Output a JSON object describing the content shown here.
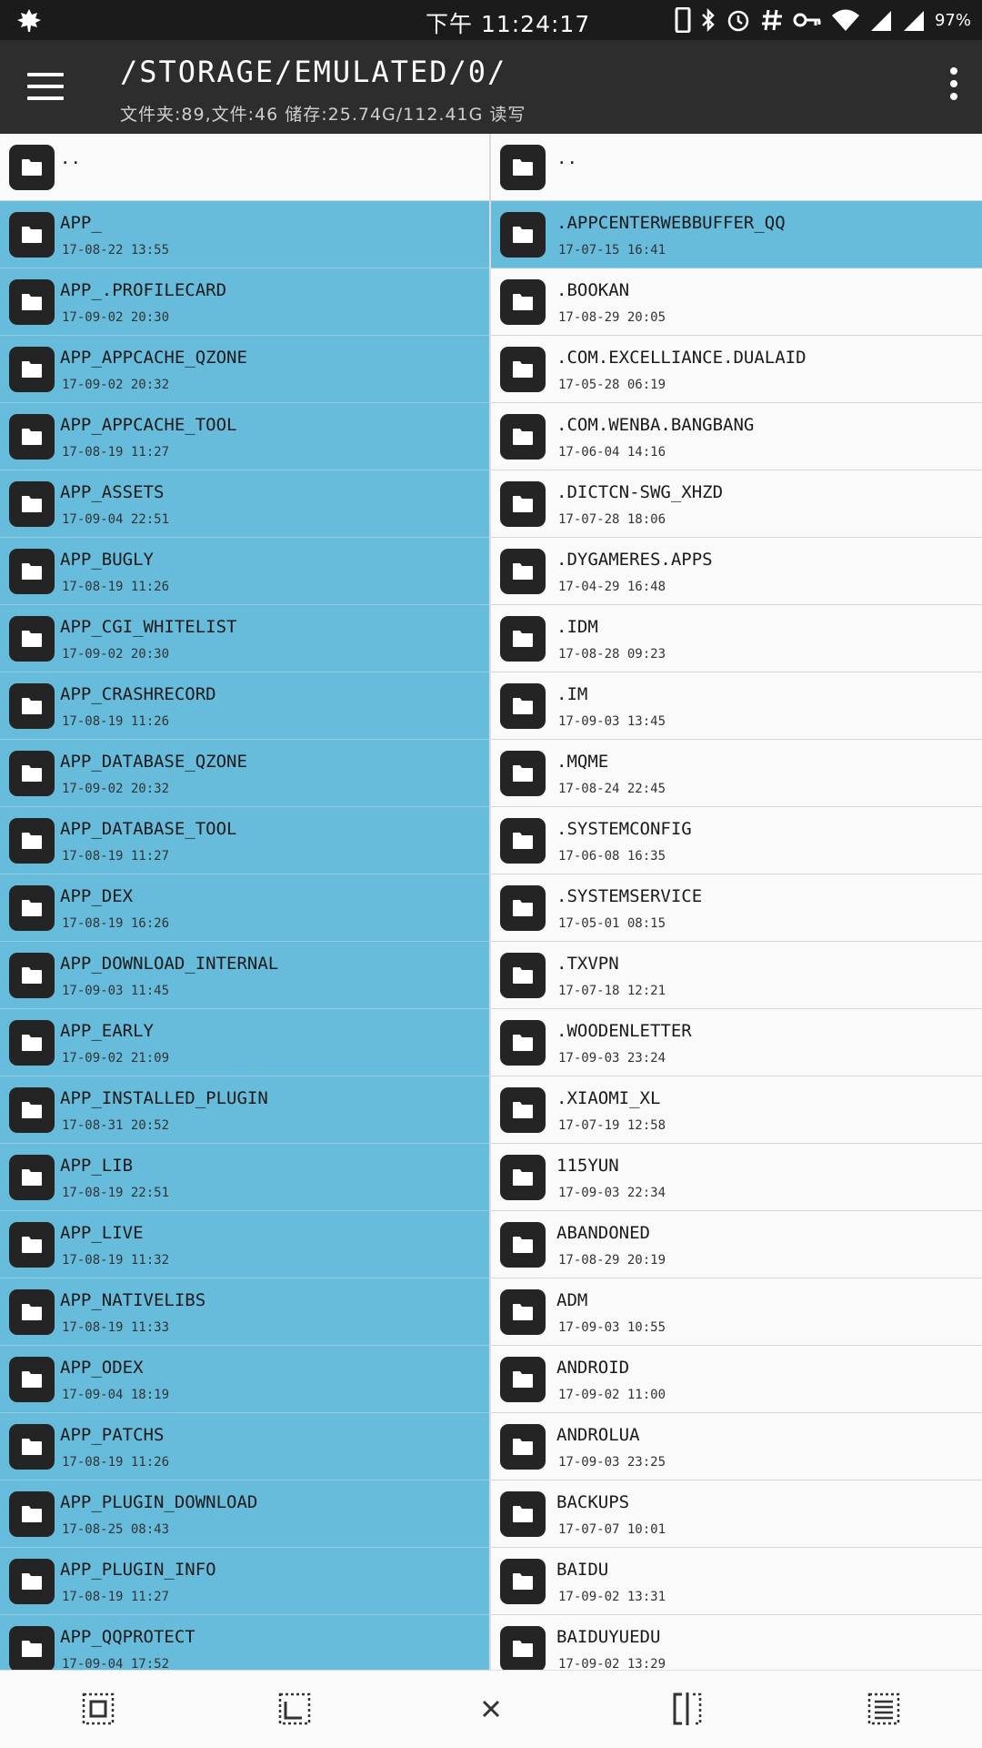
{
  "status_bar": {
    "time": "下午 11:24:17",
    "battery": "97%",
    "icons": [
      "leaf-icon",
      "phone-icon",
      "bluetooth-icon",
      "alarm-icon",
      "hash-icon",
      "key-icon",
      "wifi-icon",
      "signal-icon",
      "signal-icon",
      "battery-text"
    ]
  },
  "app_bar": {
    "path": "/STORAGE/EMULATED/0/",
    "summary": "文件夹:89,文件:46  储存:25.74G/112.41G  读写"
  },
  "left_pane": {
    "up_label": "..",
    "items": [
      {
        "name": "APP_",
        "date": "17-08-22 13:55",
        "selected": true
      },
      {
        "name": "APP_.PROFILECARD",
        "date": "17-09-02 20:30",
        "selected": true
      },
      {
        "name": "APP_APPCACHE_QZONE",
        "date": "17-09-02 20:32",
        "selected": true
      },
      {
        "name": "APP_APPCACHE_TOOL",
        "date": "17-08-19 11:27",
        "selected": true
      },
      {
        "name": "APP_ASSETS",
        "date": "17-09-04 22:51",
        "selected": true
      },
      {
        "name": "APP_BUGLY",
        "date": "17-08-19 11:26",
        "selected": true
      },
      {
        "name": "APP_CGI_WHITELIST",
        "date": "17-09-02 20:30",
        "selected": true
      },
      {
        "name": "APP_CRASHRECORD",
        "date": "17-08-19 11:26",
        "selected": true
      },
      {
        "name": "APP_DATABASE_QZONE",
        "date": "17-09-02 20:32",
        "selected": true
      },
      {
        "name": "APP_DATABASE_TOOL",
        "date": "17-08-19 11:27",
        "selected": true
      },
      {
        "name": "APP_DEX",
        "date": "17-08-19 16:26",
        "selected": true
      },
      {
        "name": "APP_DOWNLOAD_INTERNAL",
        "date": "17-09-03 11:45",
        "selected": true
      },
      {
        "name": "APP_EARLY",
        "date": "17-09-02 21:09",
        "selected": true
      },
      {
        "name": "APP_INSTALLED_PLUGIN",
        "date": "17-08-31 20:52",
        "selected": true
      },
      {
        "name": "APP_LIB",
        "date": "17-08-19 22:51",
        "selected": true
      },
      {
        "name": "APP_LIVE",
        "date": "17-08-19 11:32",
        "selected": true
      },
      {
        "name": "APP_NATIVELIBS",
        "date": "17-08-19 11:33",
        "selected": true
      },
      {
        "name": "APP_ODEX",
        "date": "17-09-04 18:19",
        "selected": true
      },
      {
        "name": "APP_PATCHS",
        "date": "17-08-19 11:26",
        "selected": true
      },
      {
        "name": "APP_PLUGIN_DOWNLOAD",
        "date": "17-08-25 08:43",
        "selected": true
      },
      {
        "name": "APP_PLUGIN_INFO",
        "date": "17-08-19 11:27",
        "selected": true
      },
      {
        "name": "APP_QQPROTECT",
        "date": "17-09-04 17:52",
        "selected": true
      }
    ]
  },
  "right_pane": {
    "up_label": "..",
    "items": [
      {
        "name": ".APPCENTERWEBBUFFER_QQ",
        "date": "17-07-15 16:41",
        "selected": true
      },
      {
        "name": ".BOOKAN",
        "date": "17-08-29 20:05",
        "selected": false
      },
      {
        "name": ".COM.EXCELLIANCE.DUALAID",
        "date": "17-05-28 06:19",
        "selected": false
      },
      {
        "name": ".COM.WENBA.BANGBANG",
        "date": "17-06-04 14:16",
        "selected": false
      },
      {
        "name": ".DICTCN-SWG_XHZD",
        "date": "17-07-28 18:06",
        "selected": false
      },
      {
        "name": ".DYGAMERES.APPS",
        "date": "17-04-29 16:48",
        "selected": false
      },
      {
        "name": ".IDM",
        "date": "17-08-28 09:23",
        "selected": false
      },
      {
        "name": ".IM",
        "date": "17-09-03 13:45",
        "selected": false
      },
      {
        "name": ".MQME",
        "date": "17-08-24 22:45",
        "selected": false
      },
      {
        "name": ".SYSTEMCONFIG",
        "date": "17-06-08 16:35",
        "selected": false
      },
      {
        "name": ".SYSTEMSERVICE",
        "date": "17-05-01 08:15",
        "selected": false
      },
      {
        "name": ".TXVPN",
        "date": "17-07-18 12:21",
        "selected": false
      },
      {
        "name": ".WOODENLETTER",
        "date": "17-09-03 23:24",
        "selected": false
      },
      {
        "name": ".XIAOMI_XL",
        "date": "17-07-19 12:58",
        "selected": false
      },
      {
        "name": "115YUN",
        "date": "17-09-03 22:34",
        "selected": false
      },
      {
        "name": "ABANDONED",
        "date": "17-08-29 20:19",
        "selected": false
      },
      {
        "name": "ADM",
        "date": "17-09-03 10:55",
        "selected": false
      },
      {
        "name": "ANDROID",
        "date": "17-09-02 11:00",
        "selected": false
      },
      {
        "name": "ANDROLUA",
        "date": "17-09-03 23:25",
        "selected": false
      },
      {
        "name": "BACKUPS",
        "date": "17-07-07 10:01",
        "selected": false
      },
      {
        "name": "BAIDU",
        "date": "17-09-02 13:31",
        "selected": false
      },
      {
        "name": "BAIDUYUEDU",
        "date": "17-09-02 13:29",
        "selected": false
      }
    ]
  },
  "colors": {
    "selected_row": "#67bcdc",
    "app_bar": "#2d2d2d",
    "status_bar": "#1b1b1b",
    "folder_icon_bg": "#242424"
  },
  "bottom_bar": {
    "buttons": [
      "select-all-icon",
      "select-partial-icon",
      "close-icon",
      "split-pane-icon",
      "list-icon"
    ]
  }
}
